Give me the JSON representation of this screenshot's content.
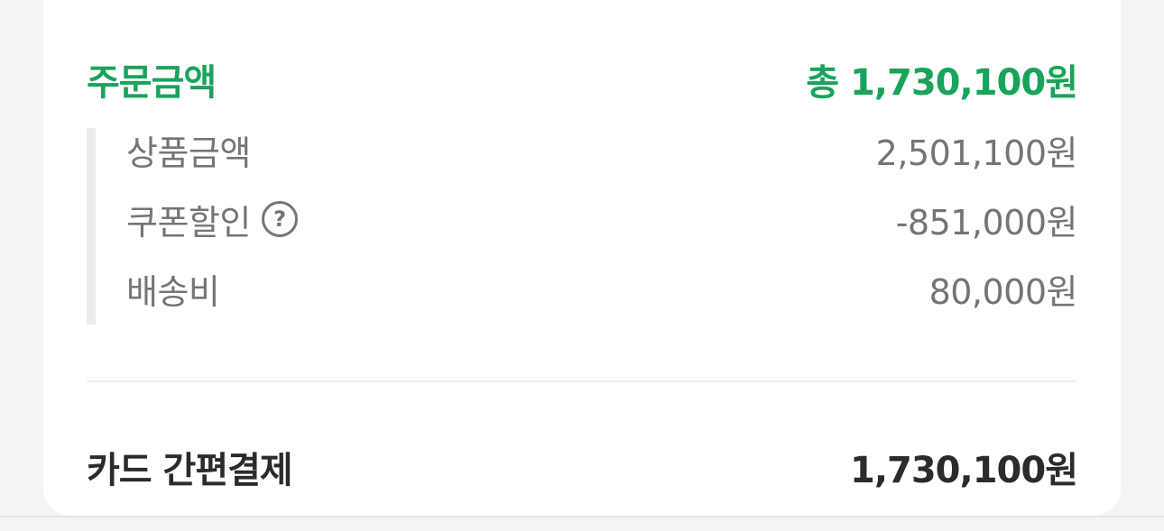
{
  "summary": {
    "label": "주문금액",
    "total": "총 1,730,100원"
  },
  "breakdown": [
    {
      "label": "상품금액",
      "value": "2,501,100원"
    },
    {
      "label": "쿠폰할인",
      "value": "-851,000원",
      "help_icon": "question-circle-icon"
    },
    {
      "label": "배송비",
      "value": "80,000원"
    }
  ],
  "payment": {
    "method": "카드 간편결제",
    "amount": "1,730,100원"
  },
  "colors": {
    "accent": "#1aa35b",
    "muted_text": "#757575",
    "strong_text": "#2b2b2b"
  }
}
